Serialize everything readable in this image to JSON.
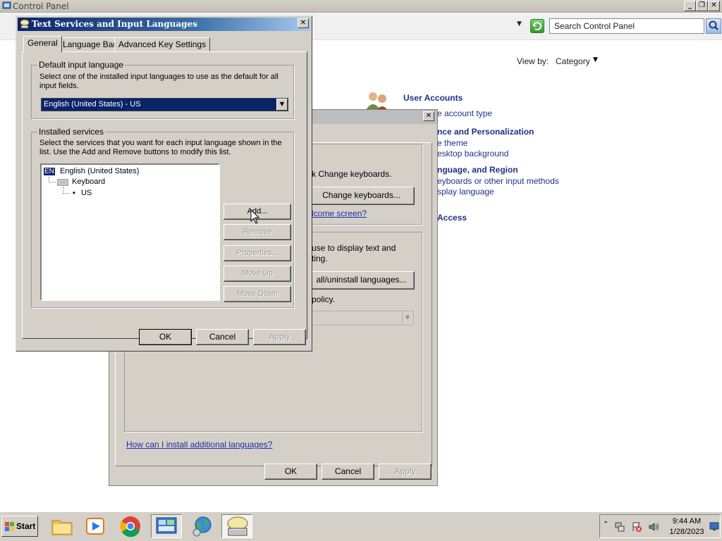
{
  "control_panel": {
    "title": "Control Panel",
    "search_placeholder": "Search Control Panel",
    "view_by_label": "View by:",
    "view_by_value": "Category",
    "categories": [
      {
        "heading": "User Accounts",
        "link": "e account type"
      },
      {
        "heading": "nce and Personalization",
        "link1": "e theme",
        "link2": "esktop background"
      },
      {
        "heading": "nguage, and Region",
        "link1": "eyboards or other input methods",
        "link2": "splay language"
      },
      {
        "heading": "Access"
      }
    ]
  },
  "region_dialog": {
    "keyboards_text": "k Change keyboards.",
    "change_keyboards_button": "Change keyboards...",
    "welcome_link": "lcome screen?",
    "display_text_line1": "use to display text and",
    "display_text_line2": "ting.",
    "install_languages_button": "all/uninstall languages...",
    "policy_text": "policy.",
    "help_link": "How can I install additional languages?",
    "ok": "OK",
    "cancel": "Cancel",
    "apply": "Apply"
  },
  "ts_dialog": {
    "title": "Text Services and Input Languages",
    "tabs": [
      "General",
      "Language Bar",
      "Advanced Key Settings"
    ],
    "default_group_label": "Default input language",
    "default_desc": "Select one of the installed input languages to use as the default for all input fields.",
    "default_value": "English (United States) - US",
    "installed_group_label": "Installed services",
    "installed_desc": "Select the services that you want for each input language shown in the list. Use the Add and Remove buttons to modify this list.",
    "tree": {
      "badge": "EN",
      "language": "English (United States)",
      "category": "Keyboard",
      "layout": "US"
    },
    "buttons": {
      "add": "Add...",
      "remove": "Remove",
      "properties": "Properties...",
      "move_up": "Move Up",
      "move_down": "Move Down"
    },
    "ok": "OK",
    "cancel": "Cancel",
    "apply": "Apply"
  },
  "taskbar": {
    "start_label": "Start",
    "apps": [
      "file-explorer-icon",
      "media-player-icon",
      "chrome-icon",
      "control-panel-icon",
      "globe-icon",
      "text-services-icon"
    ],
    "time": "9:44 AM",
    "date": "1/28/2023"
  }
}
